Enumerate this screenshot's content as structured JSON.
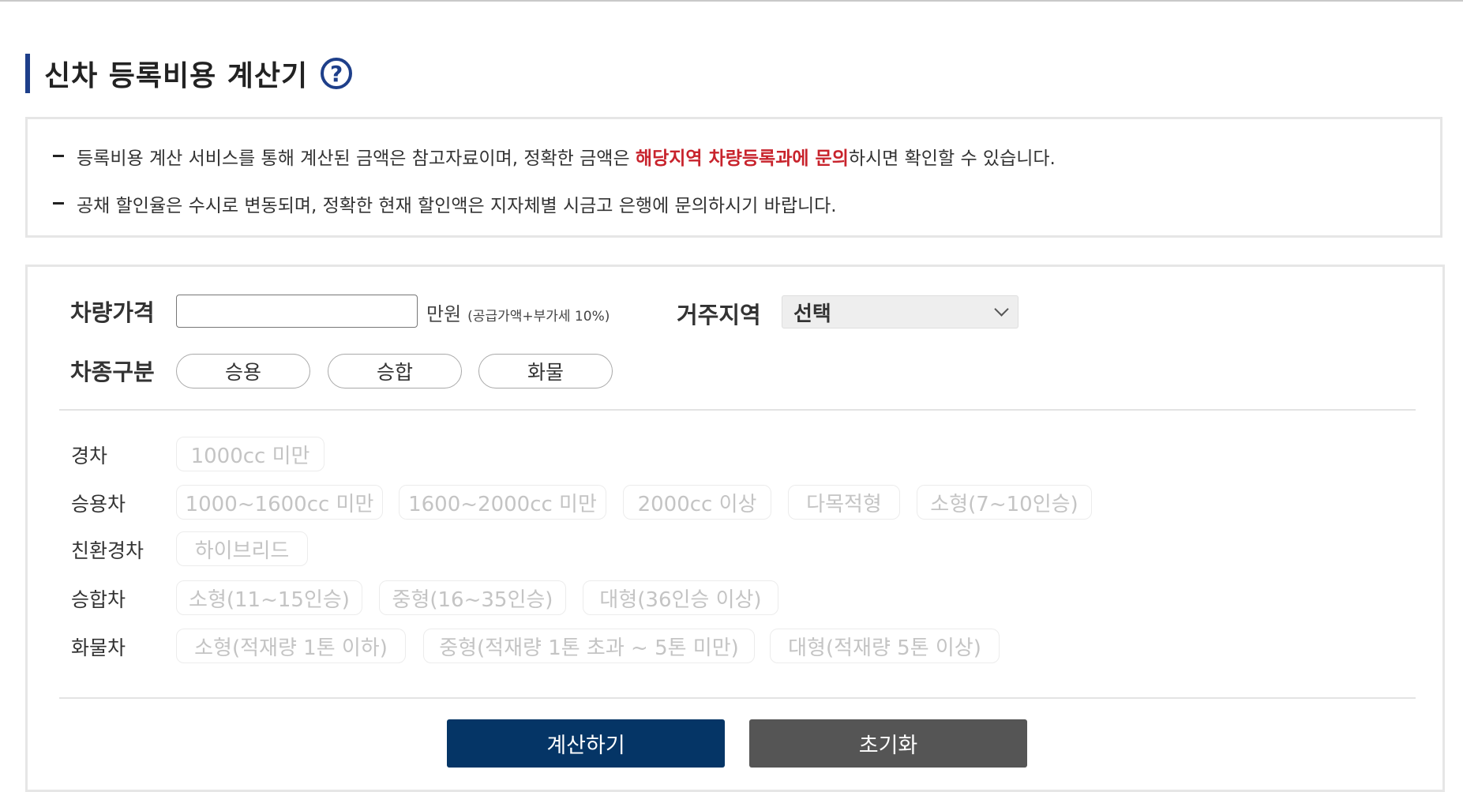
{
  "header": {
    "title": "신차 등록비용 계산기",
    "help_icon_glyph": "?"
  },
  "notice": {
    "line1_before": "등록비용 계산 서비스를 통해 계산된 금액은 참고자료이며, 정확한 금액은 ",
    "line1_highlight": "해당지역 차량등록과에 문의",
    "line1_after": "하시면 확인할 수 있습니다.",
    "line2": "공채 할인율은 수시로 변동되며, 정확한 현재 할인액은 지자체별 시금고 은행에 문의하시기 바랍니다."
  },
  "form": {
    "price_label": "차량가격",
    "price_value": "",
    "price_unit": "만원",
    "price_unit_note": "(공급가액+부가세 10%)",
    "region_label": "거주지역",
    "region_selected": "선택",
    "type_label": "차종구분",
    "type_buttons": [
      "승용",
      "승합",
      "화물"
    ]
  },
  "categories": [
    {
      "label": "경차",
      "options": [
        "1000cc 미만"
      ]
    },
    {
      "label": "승용차",
      "options": [
        "1000~1600cc 미만",
        "1600~2000cc 미만",
        "2000cc 이상",
        "다목적형",
        "소형(7~10인승)"
      ]
    },
    {
      "label": "친환경차",
      "options": [
        "하이브리드"
      ]
    },
    {
      "label": "승합차",
      "options": [
        "소형(11~15인승)",
        "중형(16~35인승)",
        "대형(36인승 이상)"
      ]
    },
    {
      "label": "화물차",
      "options": [
        "소형(적재량 1톤 이하)",
        "중형(적재량 1톤 초과 ~ 5톤 미만)",
        "대형(적재량 5톤 이상)"
      ]
    }
  ],
  "actions": {
    "calculate_label": "계산하기",
    "reset_label": "초기화"
  },
  "colors": {
    "accent": "#1e3f8a",
    "highlight": "#c8232c",
    "primary_button": "#053566",
    "secondary_button": "#555555",
    "disabled_text": "#c4c4c4"
  }
}
